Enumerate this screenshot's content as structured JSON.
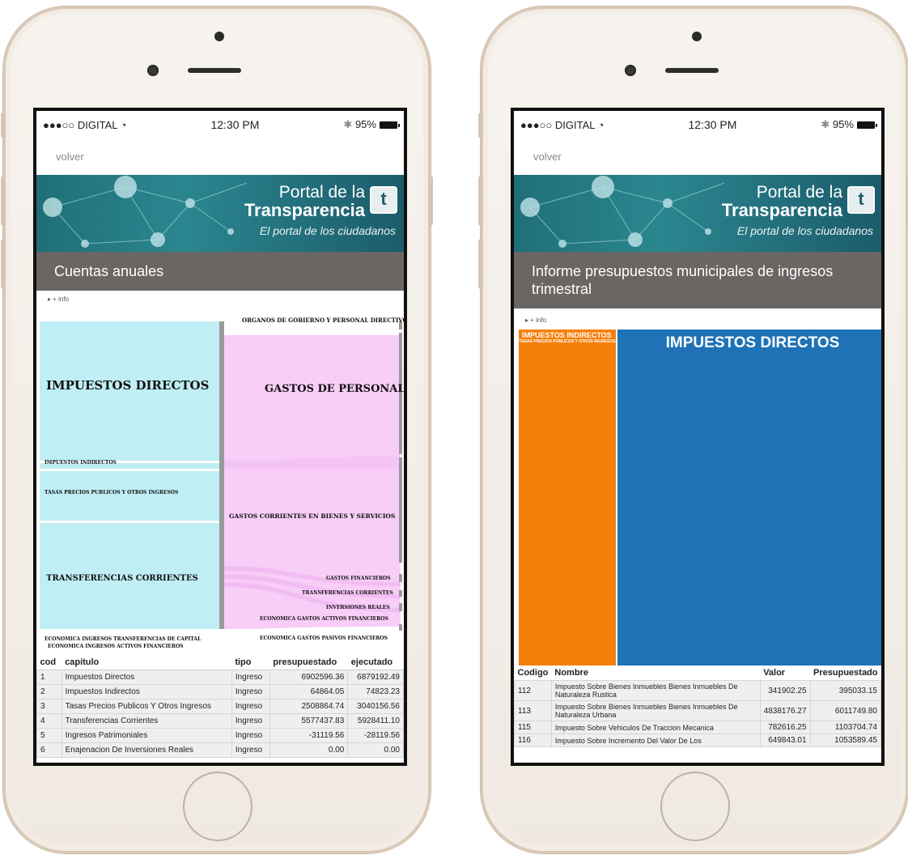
{
  "colors": {
    "sankey_left": "#bfeef5",
    "sankey_right": "#f8cdf8",
    "node_bar": "#9a9a9a",
    "title_bar": "#6a6664",
    "treemap_orange": "#f57f0b",
    "treemap_blue": "#1f72b6"
  },
  "left_phone": {
    "status": {
      "carrier": "●●●○○ DIGITAL",
      "wifi_icon": "wifi-icon",
      "time": "12:30 PM",
      "bluetooth_icon": "bluetooth-icon",
      "battery": "95%"
    },
    "back_label": "volver",
    "banner": {
      "line1": "Portal de la",
      "line2": "Transparencia",
      "line3": "El portal de los ciudadanos",
      "logo": "t"
    },
    "section_title": "Cuentas anuales",
    "info_label": "▸ + info",
    "sankey": {
      "left_labels": {
        "impuestos_directos": "IMPUESTOS DIRECTOS",
        "impuestos_indirectos": "IMPUESTOS INDIRECTOS",
        "tasas": "TASAS PRECIOS PUBLICOS Y OTROS INGRESOS",
        "transferencias": "TRANSFERENCIAS CORRIENTES",
        "eco_transf_capital": "ECONOMICA INGRESOS TRANSFERENCIAS DE CAPITAL",
        "eco_activos": "ECONOMICA INGRESOS ACTIVOS FINANCIEROS"
      },
      "right_labels": {
        "organos": "ORGANOS DE GOBIERNO Y PERSONAL DIRECTIVO",
        "gastos_personal": "GASTOS DE PERSONAL",
        "gastos_corrientes": "GASTOS CORRIENTES EN BIENES Y SERVICIOS",
        "gastos_financieros": "GASTOS FINANCIEROS",
        "transferencias": "TRANSFERENCIAS CORRIENTES",
        "inversiones": "INVERSIONES REALES",
        "eco_activos": "ECONOMICA GASTOS ACTIVOS FINANCIEROS",
        "eco_pasivos": "ECONOMICA GASTOS PASIVOS FINANCIEROS"
      }
    },
    "table": {
      "headers": {
        "cod": "cod",
        "capitulo": "capitulo",
        "tipo": "tipo",
        "presupuestado": "presupuestado",
        "ejecutado": "ejecutado"
      },
      "rows": [
        {
          "cod": "1",
          "capitulo": "Impuestos Directos",
          "tipo": "Ingreso",
          "presupuestado": "6902596.36",
          "ejecutado": "6879192.49"
        },
        {
          "cod": "2",
          "capitulo": "Impuestos Indirectos",
          "tipo": "Ingreso",
          "presupuestado": "64864.05",
          "ejecutado": "74823.23"
        },
        {
          "cod": "3",
          "capitulo": "Tasas Precios Publicos Y Otros Ingresos",
          "tipo": "Ingreso",
          "presupuestado": "2508864.74",
          "ejecutado": "3040156.56"
        },
        {
          "cod": "4",
          "capitulo": "Transferencias Corrientes",
          "tipo": "Ingreso",
          "presupuestado": "5577437.83",
          "ejecutado": "5928411.10"
        },
        {
          "cod": "5",
          "capitulo": "Ingresos Patrimoniales",
          "tipo": "Ingreso",
          "presupuestado": "-31119.56",
          "ejecutado": "-28119.56"
        },
        {
          "cod": "6",
          "capitulo": "Enajenacion De Inversiones Reales",
          "tipo": "Ingreso",
          "presupuestado": "0.00",
          "ejecutado": "0.00"
        }
      ]
    }
  },
  "right_phone": {
    "status": {
      "carrier": "●●●○○ DIGITAL",
      "wifi_icon": "wifi-icon",
      "time": "12:30 PM",
      "bluetooth_icon": "bluetooth-icon",
      "battery": "95%"
    },
    "back_label": "volver",
    "banner": {
      "line1": "Portal de la",
      "line2": "Transparencia",
      "line3": "El portal de los ciudadanos",
      "logo": "t"
    },
    "section_title": "Informe presupuestos municipales de ingresos trimestral",
    "info_label": "▸ + info",
    "treemap": {
      "small_title": "IMPUESTOS INDIRECTOS",
      "small_sub": "TASAS PRECIOS PUBLICOS Y OTROS INGRESOS",
      "big_title": "IMPUESTOS DIRECTOS"
    },
    "table": {
      "headers": {
        "codigo": "Codigo",
        "nombre": "Nombre",
        "valor": "Valor",
        "presupuestado": "Presupuestado"
      },
      "rows": [
        {
          "codigo": "112",
          "nombre": "Impuesto Sobre Bienes Inmuebles Bienes Inmuebles De Naturaleza Rustica",
          "valor": "341902.25",
          "presupuestado": "395033.15"
        },
        {
          "codigo": "113",
          "nombre": "Impuesto Sobre Bienes Inmuebles Bienes Inmuebles De Naturaleza Urbana",
          "valor": "4838176.27",
          "presupuestado": "6011749.80"
        },
        {
          "codigo": "115",
          "nombre": "Impuesto Sobre Vehiculos De Traccion Mecanica",
          "valor": "782616.25",
          "presupuestado": "1103704.74"
        },
        {
          "codigo": "116",
          "nombre": "Impuesto Sobre Incremento Del Valor De Los",
          "valor": "649843.01",
          "presupuestado": "1053589.45"
        }
      ]
    }
  }
}
